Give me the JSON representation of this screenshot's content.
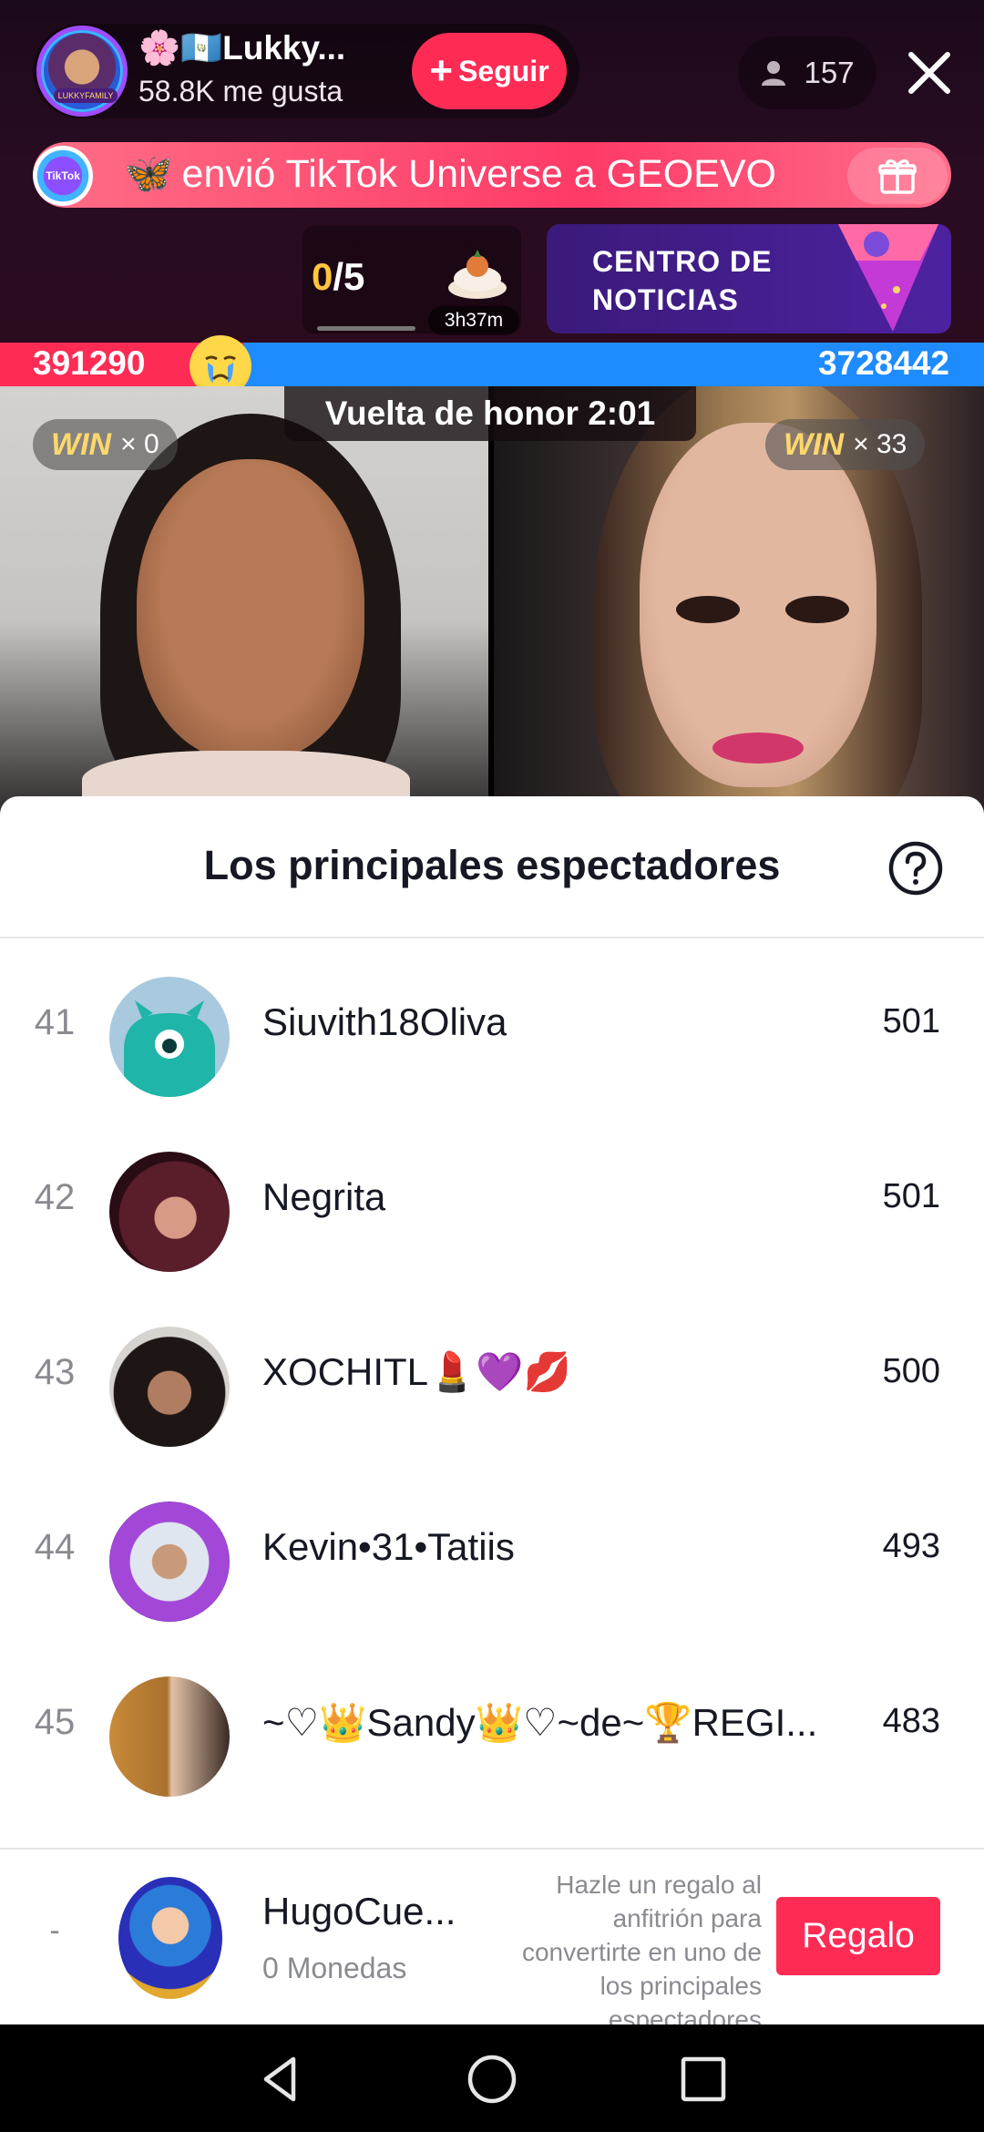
{
  "live": {
    "host_name": "🌸🇬🇹Lukky...",
    "host_likes": "58.8K me gusta",
    "host_badge": "LUKKYFAMILY",
    "follow_label": "Seguir",
    "viewer_count": "157",
    "gift_banner_text": "envió TikTok Universe a GEOEVO",
    "gift_banner_emoji": "🦋",
    "tiktok_badge": "TikTok LIVE",
    "goal": {
      "done": "0",
      "total": "/5"
    },
    "timer": "3h37m",
    "news_card": {
      "line1": "CENTRO DE",
      "line2": "NOTICIAS"
    }
  },
  "battle": {
    "left_score": "391290",
    "right_score": "3728442",
    "left_share": 0.095,
    "cry_emoji": "😭",
    "honor_lap": "Vuelta de honor 2:01",
    "left_win_label": "WIN",
    "left_win_count": "× 0",
    "right_win_label": "WIN",
    "right_win_count": "× 33"
  },
  "sheet": {
    "title": "Los principales espectadores",
    "rows": [
      {
        "rank": "41",
        "name": "Siuvith18Oliva",
        "score": "501",
        "avatar": "teal-monster"
      },
      {
        "rank": "42",
        "name": "Negrita",
        "score": "501",
        "avatar": "photo-woman"
      },
      {
        "rank": "43",
        "name": "XOCHITL💄💜💋",
        "score": "500",
        "avatar": "photo-woman-curly"
      },
      {
        "rank": "44",
        "name": "Kevin•31•Tatiis",
        "score": "493",
        "avatar": "photo-man-framed"
      },
      {
        "rank": "45",
        "name": "~♡👑Sandy👑♡~de~🏆REGI...",
        "score": "483",
        "avatar": "photo-lion-woman"
      }
    ],
    "footer": {
      "rank": "-",
      "name": "HugoCue...",
      "coins": "0 Monedas",
      "hint": "Hazle un regalo al anfitrión para convertirte en uno de los principales espectadores",
      "gift_label": "Regalo"
    }
  },
  "colors": {
    "brand_red": "#fe2c55",
    "battle_blue": "#1e8bff",
    "goal_yellow": "#ffc53d"
  }
}
